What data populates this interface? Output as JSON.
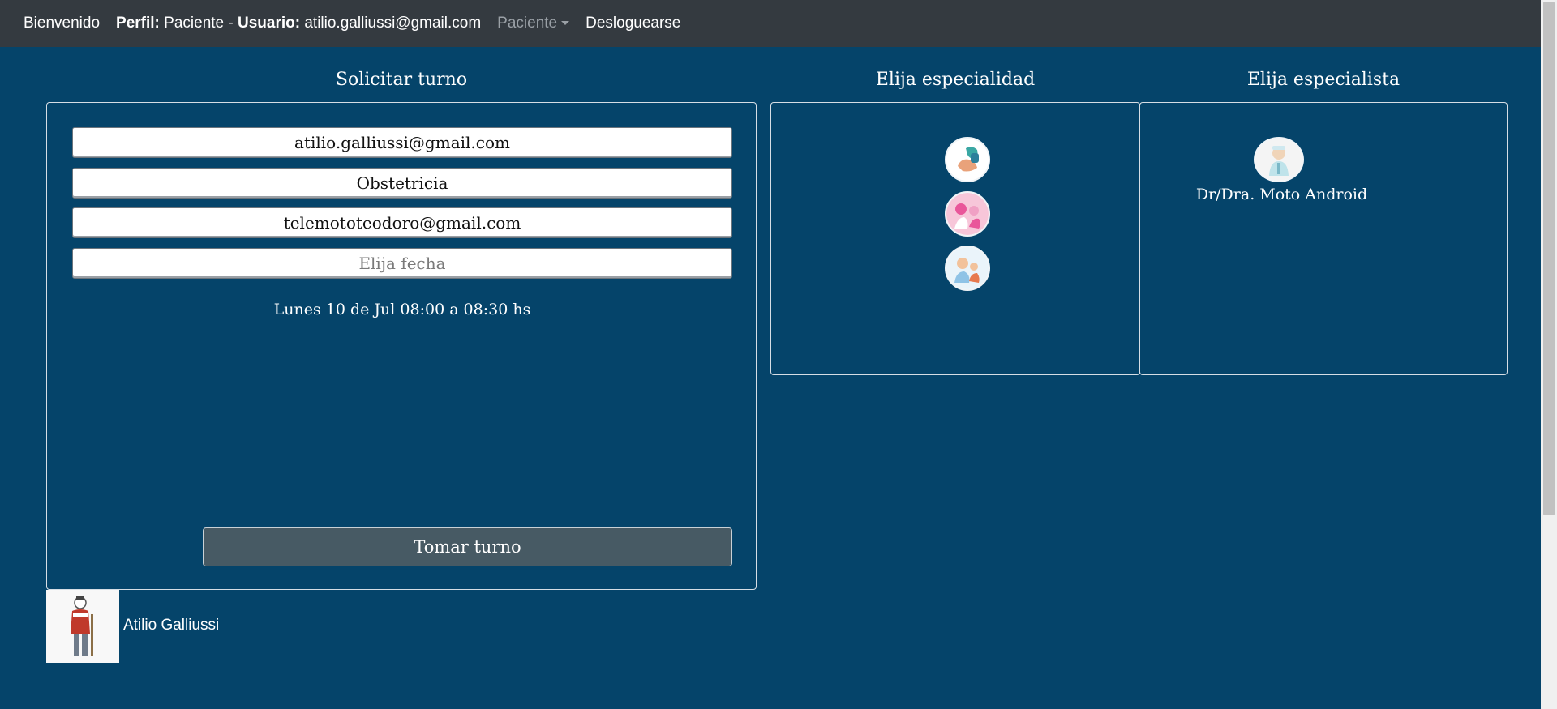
{
  "navbar": {
    "welcome": "Bienvenido",
    "profile_label": "Perfil:",
    "profile_value": "Paciente -",
    "user_label": "Usuario:",
    "user_value": "atilio.galliussi@gmail.com",
    "dropdown_label": "Paciente",
    "logout": "Desloguearse"
  },
  "form": {
    "title": "Solicitar turno",
    "patient_email": "atilio.galliussi@gmail.com",
    "specialty": "Obstetricia",
    "specialist_email": "telemototeodoro@gmail.com",
    "date_placeholder": "Elija fecha",
    "slot": "Lunes 10 de Jul 08:00 a 08:30 hs",
    "submit": "Tomar turno"
  },
  "specialties": {
    "title": "Elija especialidad",
    "icons": [
      "specialty-dentistry-icon",
      "specialty-obstetrics-icon",
      "specialty-pediatrics-icon"
    ]
  },
  "specialists": {
    "title": "Elija especialista",
    "items": [
      {
        "name": "Dr/Dra. Moto Android",
        "icon": "doctor-avatar-icon"
      }
    ]
  },
  "user": {
    "name": "Atilio Galliussi",
    "avatar_icon": "user-avatar-icon"
  },
  "colors": {
    "background": "#05446a",
    "navbar": "#343a40",
    "button": "#475a64"
  }
}
